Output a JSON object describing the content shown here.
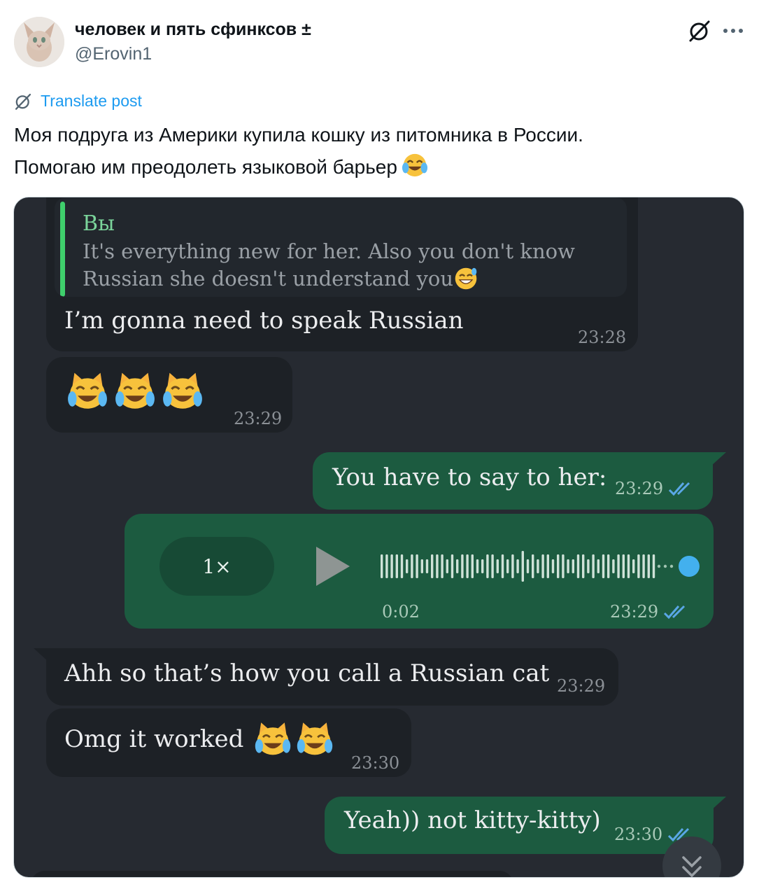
{
  "tweet": {
    "display_name": "человек и пять сфинксов ±",
    "handle": "@Erovin1",
    "translate_label": "Translate post",
    "text_line1": "Моя подруга из Америки купила кошку из питомника в России.",
    "text_line2": "Помогаю им преодолеть языковой барьер",
    "text_emoji": "face-with-tears-of-joy-emoji",
    "icons": {
      "avatar": "sphynx-cat-avatar",
      "grok": "grok-icon",
      "more": "more-dots-icon",
      "translate": "grok-icon"
    },
    "colors": {
      "link": "#1d9bf0",
      "text": "#0f1419",
      "muted": "#536471"
    }
  },
  "chat": {
    "colors": {
      "background": "#262a31",
      "incoming": "#1d2126",
      "outgoing": "#1c5b40",
      "quote_bar": "#3fcf6c",
      "read_check": "#5aa7e6"
    },
    "messages": [
      {
        "direction": "in",
        "quote_author": "Вы",
        "quote_text_line1": "It's everything new for her. Also you don't know",
        "quote_text_line2": "Russian she doesn't understand you",
        "quote_emoji": "grinning-sweat-emoji",
        "text": "I’m gonna need to speak Russian",
        "time": "23:28"
      },
      {
        "direction": "in",
        "emoji": [
          "cat-tears-of-joy-emoji",
          "cat-tears-of-joy-emoji",
          "cat-tears-of-joy-emoji"
        ],
        "time": "23:29"
      },
      {
        "direction": "out",
        "text": "You have to say to her:",
        "time": "23:29",
        "status": "read"
      },
      {
        "direction": "out",
        "type": "voice",
        "speed": "1×",
        "duration": "0:02",
        "time": "23:29",
        "status": "read"
      },
      {
        "direction": "in",
        "text": "Ahh so that’s how you call a Russian cat",
        "time": "23:29"
      },
      {
        "direction": "in",
        "text": "Omg it worked",
        "emoji": [
          "cat-tears-of-joy-emoji",
          "cat-tears-of-joy-emoji"
        ],
        "time": "23:30"
      },
      {
        "direction": "out",
        "text": "Yeah)) not kitty-kitty)",
        "time": "23:30",
        "status": "read"
      }
    ],
    "scroll_icon": "double-chevron-down-icon"
  }
}
